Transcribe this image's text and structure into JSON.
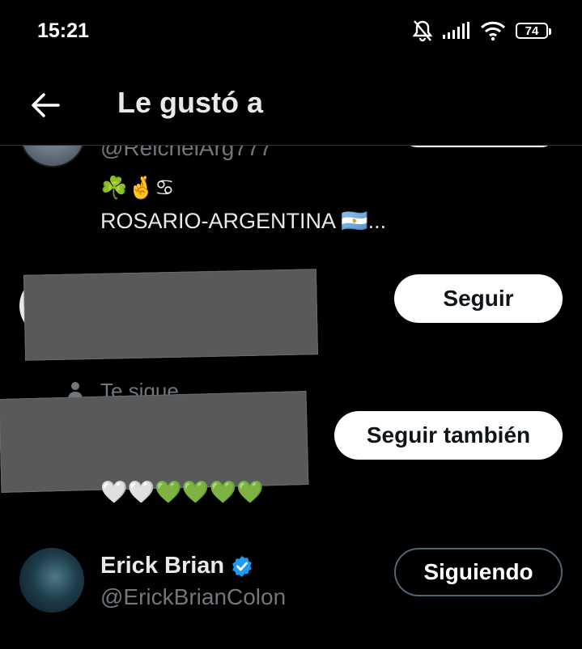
{
  "status_bar": {
    "time": "15:21",
    "battery": "74"
  },
  "header": {
    "title": "Le gustó a"
  },
  "users": [
    {
      "handle": "@ReichelArg777",
      "bio_emoji": "☘️🤞♋",
      "bio": "ROSARIO-ARGENTINA 🇦🇷..."
    },
    {
      "button": "Seguir"
    },
    {
      "follows_you": "Te sigue",
      "button": "Seguir también",
      "bio_emoji": "🤍🤍💚💚💚💚"
    },
    {
      "name": "Erick Brian",
      "handle": "@ErickBrianColon",
      "button": "Siguiendo",
      "verified": true
    }
  ],
  "colors": {
    "background": "#000000",
    "verified": "#1d9bf0",
    "muted": "#71767b"
  }
}
